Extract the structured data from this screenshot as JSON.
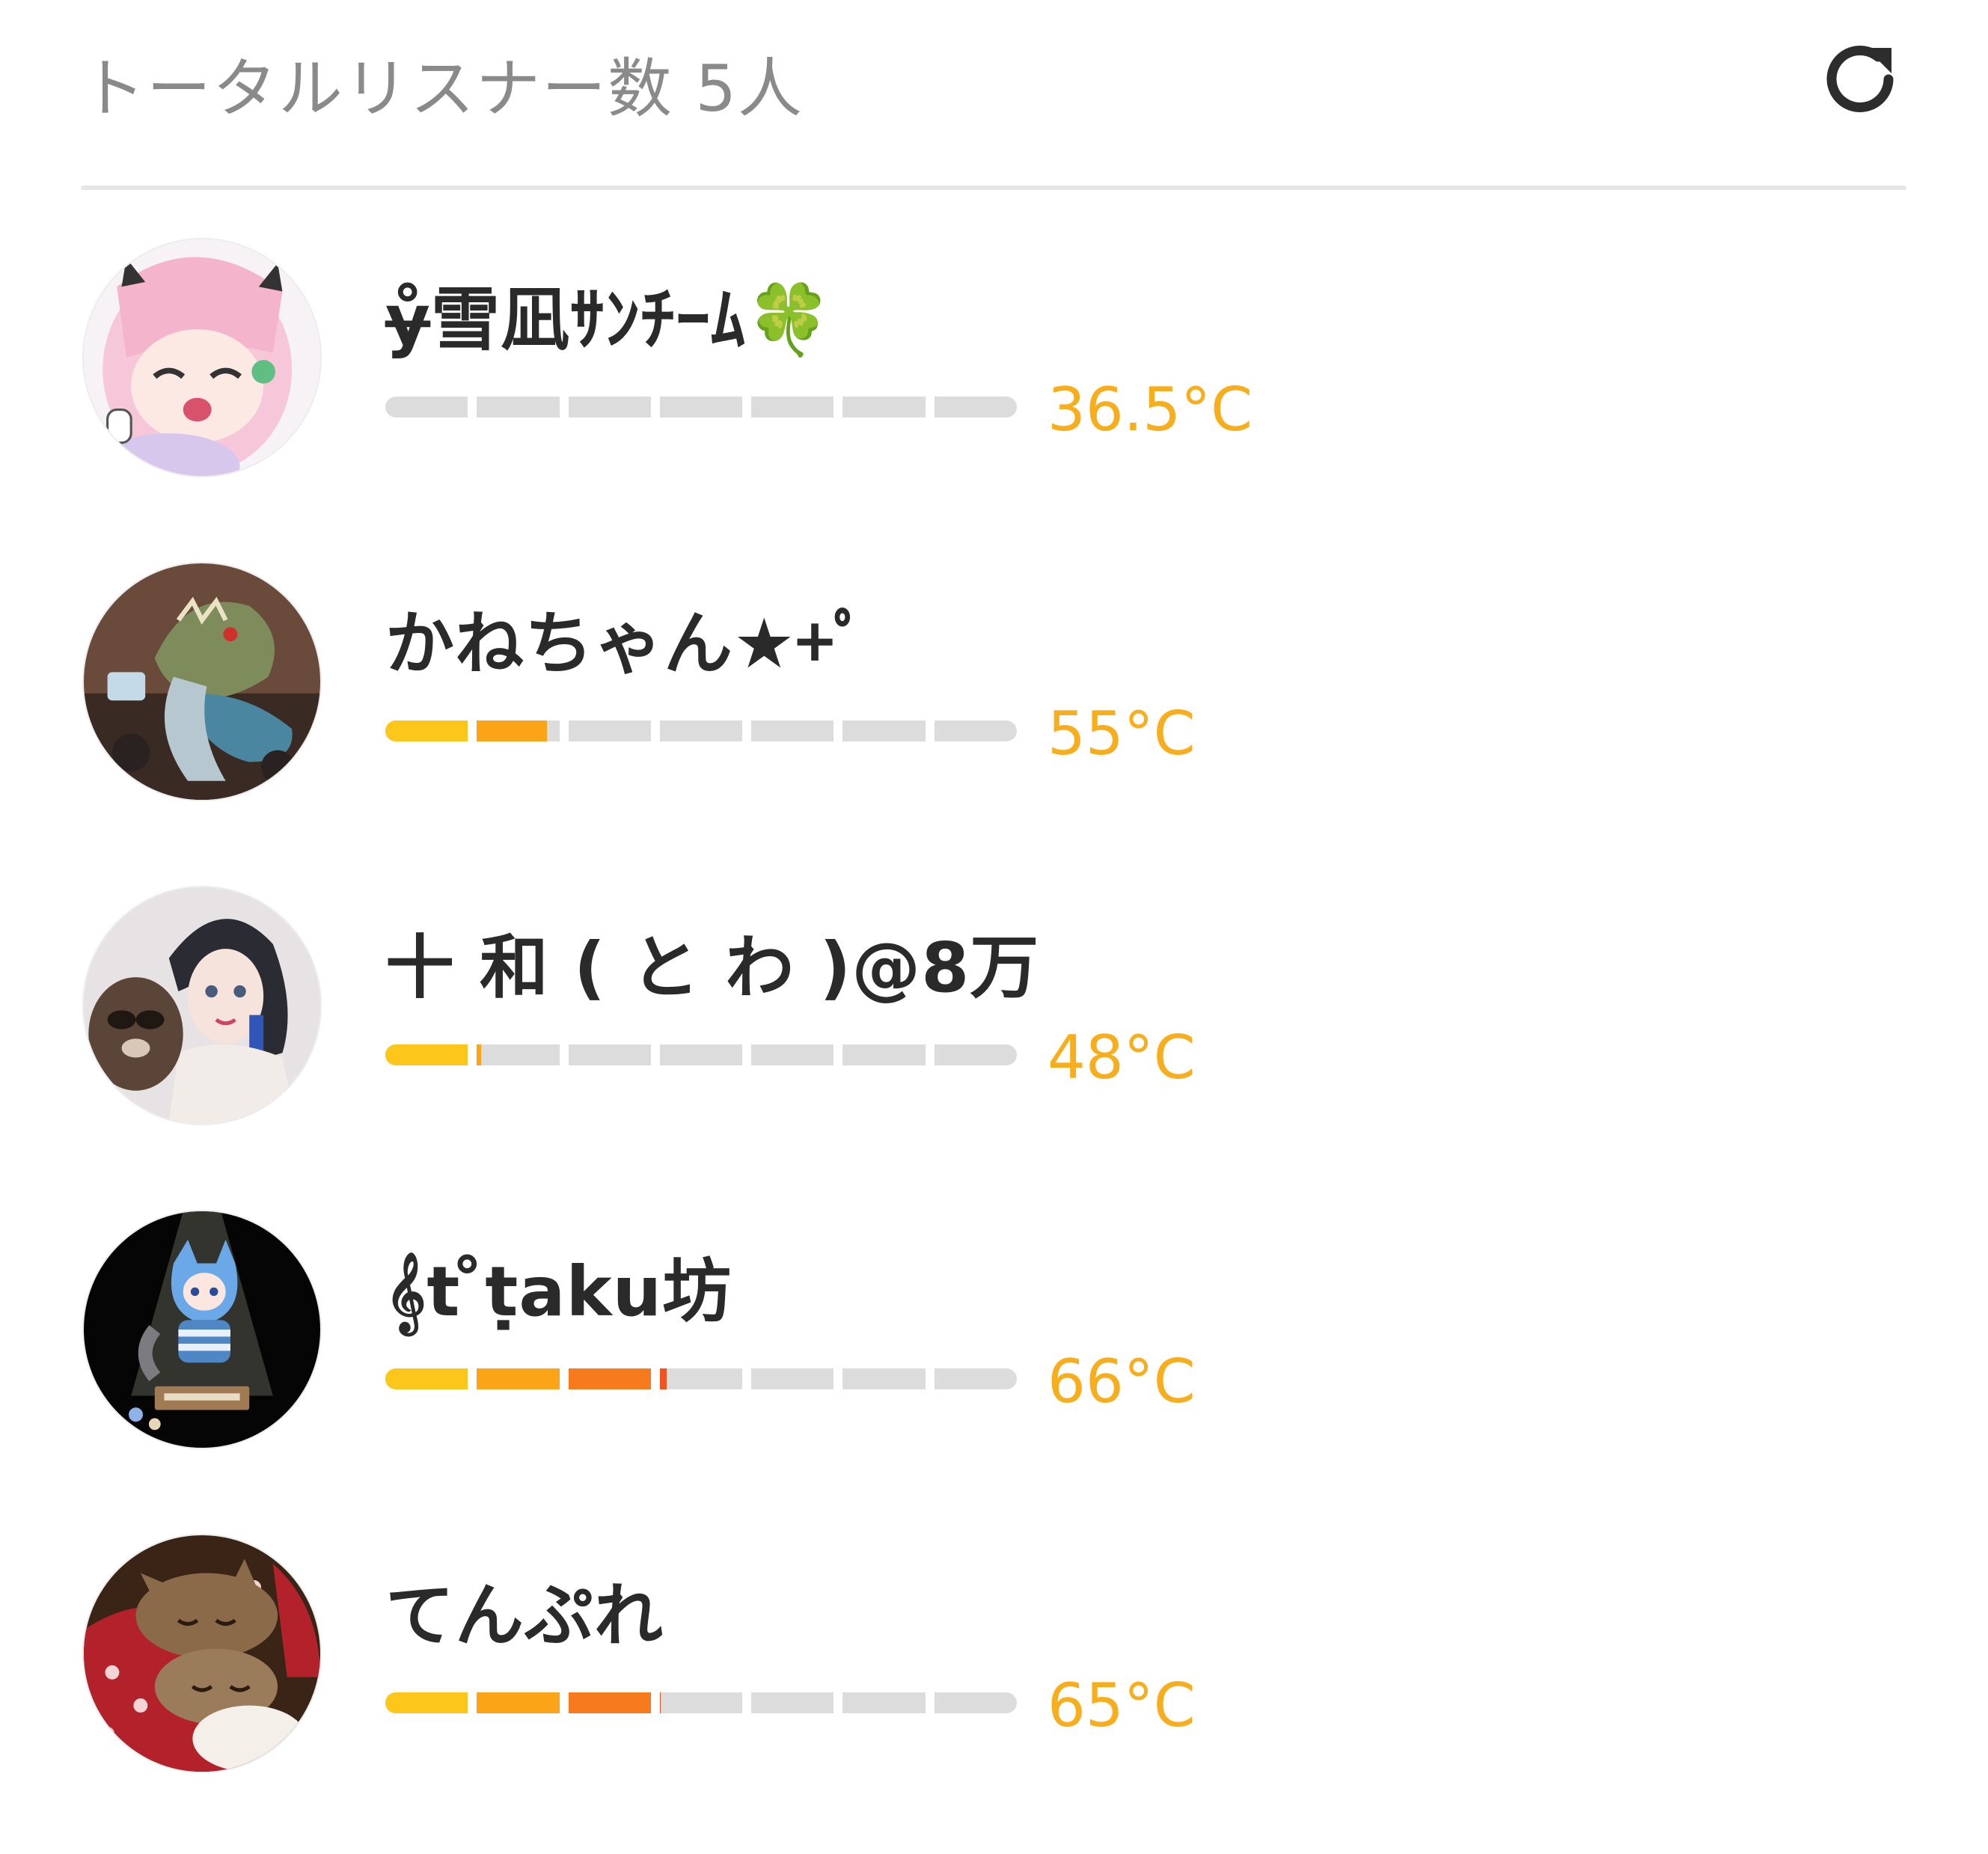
{
  "header": {
    "title": "トータルリスナー数 5人",
    "refresh_icon": "refresh-icon"
  },
  "colors": {
    "temperature_text": "#f7ad1c",
    "bar_track": "#dcdcdc",
    "segment_colors": [
      "#fcc61a",
      "#fba417",
      "#f77a1d",
      "#f2531f",
      "#e53b23",
      "#d42a26",
      "#c11f28"
    ]
  },
  "listeners": [
    {
      "name": "ɏ̊雪凪ｻﾝﾁｰﾑ🍀",
      "temperature": "36.5°C",
      "level": 0.0,
      "avatar": "anime-girl-pink-hair"
    },
    {
      "name": "かねちゃん★+ﾟ",
      "temperature": "55°C",
      "level": 0.264,
      "avatar": "dinosaur-plush"
    },
    {
      "name": "十 和 ( と わ )@8万",
      "temperature": "48°C",
      "level": 0.15,
      "avatar": "anime-girl-black-hair-with-raccoon"
    },
    {
      "name": "𝄞t ̊ṭaku坊",
      "temperature": "66°C",
      "level": 0.44,
      "avatar": "blue-cat-character-spotlight"
    },
    {
      "name": "てんぷれ",
      "temperature": "65°C",
      "level": 0.43,
      "avatar": "cats-on-red-cushion"
    }
  ]
}
